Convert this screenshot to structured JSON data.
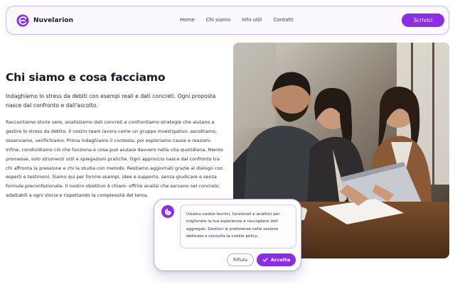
{
  "header": {
    "brand_name": "Nuvelarion",
    "nav": [
      {
        "label": "Home"
      },
      {
        "label": "Chi siamo"
      },
      {
        "label": "Info utili"
      },
      {
        "label": "Contatti"
      }
    ],
    "cta_label": "Scrivici"
  },
  "main": {
    "title": "Chi siamo e cosa facciamo",
    "lead": "Indaghiamo lo stress da debiti con esempi reali e dati concreti. Ogni proposta nasce dal confronto e dall'ascolto.",
    "body": "Raccontiamo storie vere, analizziamo dati concreti e confrontiamo strategie che aiutano a gestire lo stress da debito. Il nostro team lavora come un gruppo investigativo: ascoltiamo, osserviamo, verifichiamo. Prima indaghiamo il contesto, poi esploriamo cause e reazioni. Infine, condividiamo ciò che funziona e cosa può aiutare davvero nella vita quotidiana. Niente promesse, solo strumenti utili e spiegazioni pratiche. Ogni approccio nasce dal confronto tra chi affronta la pressione e chi la studia con metodo. Restiamo aggiornati grazie al dialogo con esperti e testimoni. Siamo qui per fornire esempi, idee e supporto, senza giudicare e senza formule preconfezionate. Il nostro obiettivo è chiaro: offrire analisi che servano nel concreto, adattabili a ogni storia e rispettando la complessità del tema."
  },
  "hero_image": {
    "description_icon": "photo-three-people-meeting"
  },
  "cookie_banner": {
    "icon": "cookie-icon",
    "text": "Usiamo cookie tecnici, funzionali e analitici per migliorare la tua esperienza e raccogliere dati aggregati. Gestisci le preferenze nella sezione dedicata o consulta la cookie policy.",
    "reject_label": "Rifiuta",
    "accept_label": "Accetta"
  },
  "colors": {
    "accent": "#8b2de2",
    "border": "#c9b8f0",
    "text": "#1d1a2b"
  }
}
